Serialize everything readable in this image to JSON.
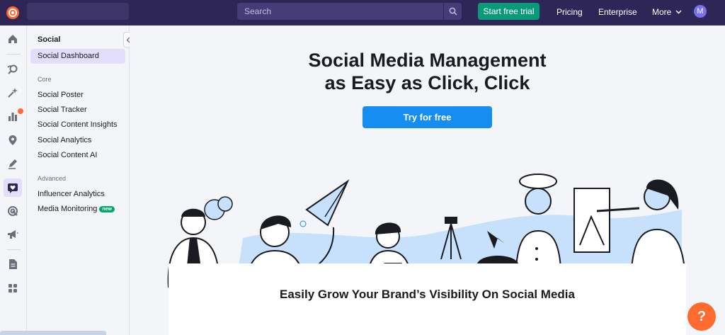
{
  "topbar": {
    "search_placeholder": "Search",
    "trial_label": "Start free trial",
    "pricing_label": "Pricing",
    "enterprise_label": "Enterprise",
    "more_label": "More",
    "avatar_initial": "M"
  },
  "sidebar": {
    "title": "Social",
    "active_item": "Social Dashboard",
    "core_label": "Core",
    "core_items": [
      "Social Poster",
      "Social Tracker",
      "Social Content Insights",
      "Social Analytics",
      "Social Content AI"
    ],
    "advanced_label": "Advanced",
    "advanced_items": [
      "Influencer Analytics",
      "Media Monitoring"
    ],
    "new_badge": "new"
  },
  "rail": {
    "icons": [
      "home-icon",
      "seo-icon",
      "ai-sparkle-icon",
      "bar-chart-icon",
      "location-pin-icon",
      "pen-icon",
      "social-heart-icon",
      "target-icon",
      "megaphone-icon",
      "document-icon",
      "apps-grid-icon"
    ]
  },
  "main": {
    "hero_line1": "Social Media Management",
    "hero_line2": "as Easy as Click, Click",
    "cta_label": "Try for free",
    "card_title": "Easily Grow Your Brand’s Visibility On Social Media",
    "help_label": "?"
  },
  "colors": {
    "topbar": "#2f2658",
    "accent_green": "#0a9a79",
    "cta_blue": "#168df0",
    "active_purple": "#e3defc",
    "help_orange": "#ff6a2f",
    "illustration_blue": "#c7e0fb"
  }
}
